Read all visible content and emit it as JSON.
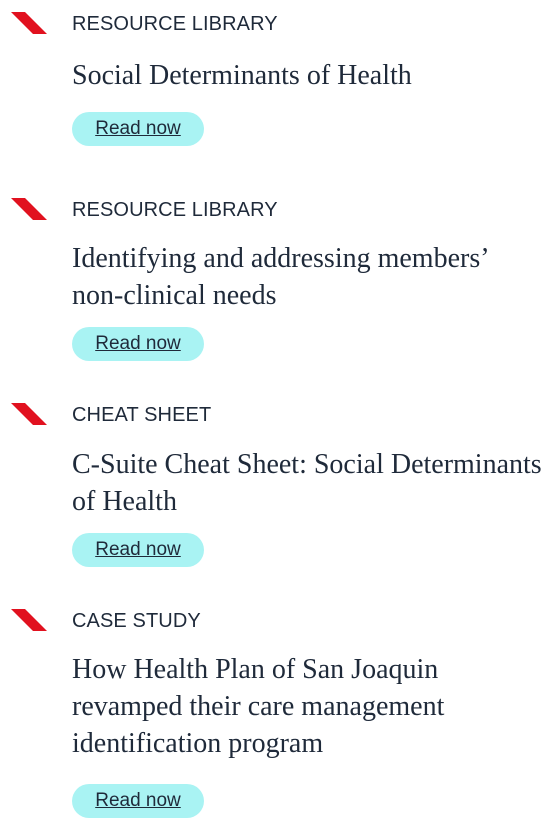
{
  "accent_color": "#e1111f",
  "button_color": "#a9f3f3",
  "text_color": "#1f2a3a",
  "marker_icon": "red-parallelogram-icon",
  "items": [
    {
      "category": "RESOURCE LIBRARY",
      "title": "Social Determinants of Health",
      "button": "Read now"
    },
    {
      "category": "RESOURCE LIBRARY",
      "title": "Identifying and addressing members’ non-clinical needs",
      "button": "Read now"
    },
    {
      "category": "CHEAT SHEET",
      "title": "C-Suite Cheat Sheet: Social Determinants of Health",
      "button": "Read now"
    },
    {
      "category": "CASE STUDY",
      "title": "How Health Plan of San Joaquin revamped their care management identification program",
      "button": "Read now"
    }
  ]
}
